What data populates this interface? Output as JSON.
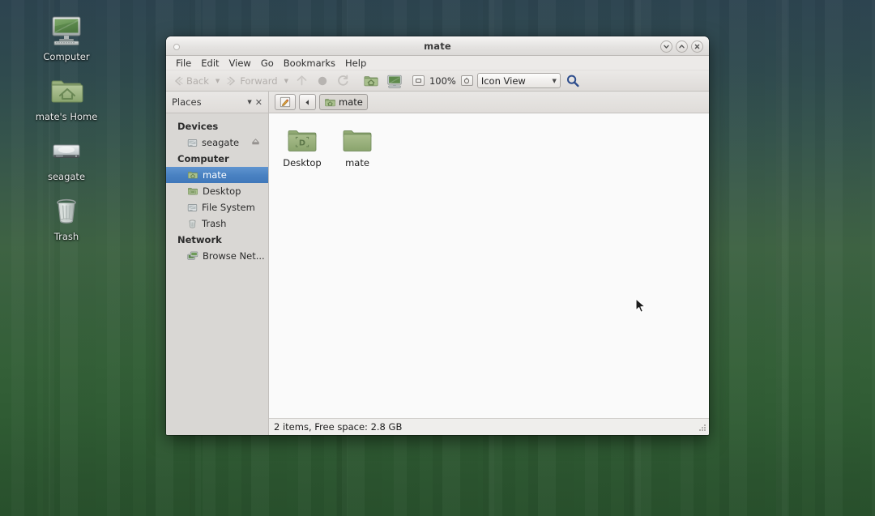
{
  "desktop": {
    "icons": [
      {
        "label": "Computer",
        "icon": "computer-icon"
      },
      {
        "label": "mate's Home",
        "icon": "home-folder-icon"
      },
      {
        "label": "seagate",
        "icon": "harddisk-icon"
      },
      {
        "label": "Trash",
        "icon": "trash-icon"
      }
    ],
    "wallpaper_top_color": "#2d4450",
    "wallpaper_bottom_color": "#28502c"
  },
  "window": {
    "title": "mate",
    "controls": {
      "minimize": "minimize-button",
      "maximize": "maximize-button",
      "close": "close-button"
    },
    "menubar": [
      {
        "label": "File"
      },
      {
        "label": "Edit"
      },
      {
        "label": "View"
      },
      {
        "label": "Go"
      },
      {
        "label": "Bookmarks"
      },
      {
        "label": "Help"
      }
    ],
    "toolbar": {
      "back_label": "Back",
      "forward_label": "Forward",
      "back_enabled": false,
      "forward_enabled": false,
      "up_icon": "up-arrow-icon",
      "stop_icon": "stop-icon",
      "reload_icon": "reload-icon",
      "home_icon": "home-folder-icon",
      "computer_icon": "computer-icon",
      "zoom_out_icon": "zoom-out-icon",
      "zoom_level": "100%",
      "zoom_reset_icon": "zoom-reset-icon",
      "view_mode": "Icon View",
      "search_icon": "search-icon"
    },
    "pathbar": {
      "places_label": "Places",
      "places_dropdown_icon": "chevron-down-icon",
      "places_close_icon": "close-icon",
      "edit_location_icon": "edit-location-icon",
      "back_crumb_icon": "left-arrow-icon",
      "breadcrumb_label": "mate",
      "breadcrumb_icon": "home-folder-icon"
    },
    "sidebar": {
      "groups": [
        {
          "title": "Devices",
          "items": [
            {
              "label": "seagate",
              "icon": "drive-icon",
              "selected": false,
              "eject": true
            }
          ]
        },
        {
          "title": "Computer",
          "items": [
            {
              "label": "mate",
              "icon": "home-folder-icon",
              "selected": true,
              "eject": false
            },
            {
              "label": "Desktop",
              "icon": "desktop-folder-icon",
              "selected": false,
              "eject": false
            },
            {
              "label": "File System",
              "icon": "drive-icon",
              "selected": false,
              "eject": false
            },
            {
              "label": "Trash",
              "icon": "trash-icon",
              "selected": false,
              "eject": false
            }
          ]
        },
        {
          "title": "Network",
          "items": [
            {
              "label": "Browse Net...",
              "icon": "network-icon",
              "selected": false,
              "eject": false
            }
          ]
        }
      ],
      "selection_color": "#4a82c2"
    },
    "files": [
      {
        "label": "Desktop",
        "icon": "desktop-folder-icon"
      },
      {
        "label": "mate",
        "icon": "folder-icon"
      }
    ],
    "statusbar": {
      "text": "2 items, Free space: 2.8 GB"
    }
  }
}
